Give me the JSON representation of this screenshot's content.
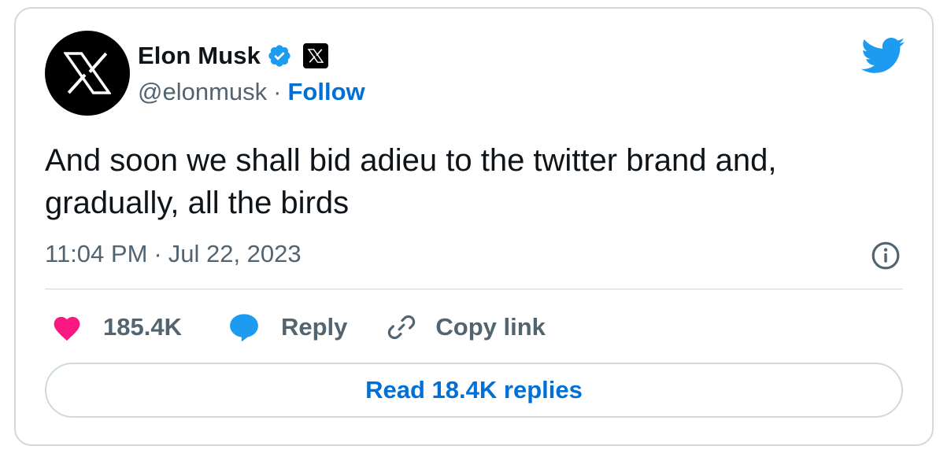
{
  "author": {
    "display_name": "Elon Musk",
    "handle": "@elonmusk",
    "separator": "·",
    "follow_label": "Follow",
    "avatar_icon": "x-logo-icon",
    "verified_icon": "verified-badge-icon",
    "affiliation_icon": "x-affiliation-icon"
  },
  "tweet": {
    "text": "And soon we shall bid adieu to the twitter brand and, gradually, all the birds",
    "time": "11:04 PM",
    "separator": "·",
    "date": "Jul 22, 2023"
  },
  "actions": {
    "like_count": "185.4K",
    "reply_label": "Reply",
    "copy_link_label": "Copy link"
  },
  "read_replies_label": "Read 18.4K replies",
  "colors": {
    "accent": "#1d9bf0",
    "link": "#006fd6",
    "like": "#f91880",
    "secondary_text": "#536471",
    "border": "#cfd9de"
  }
}
